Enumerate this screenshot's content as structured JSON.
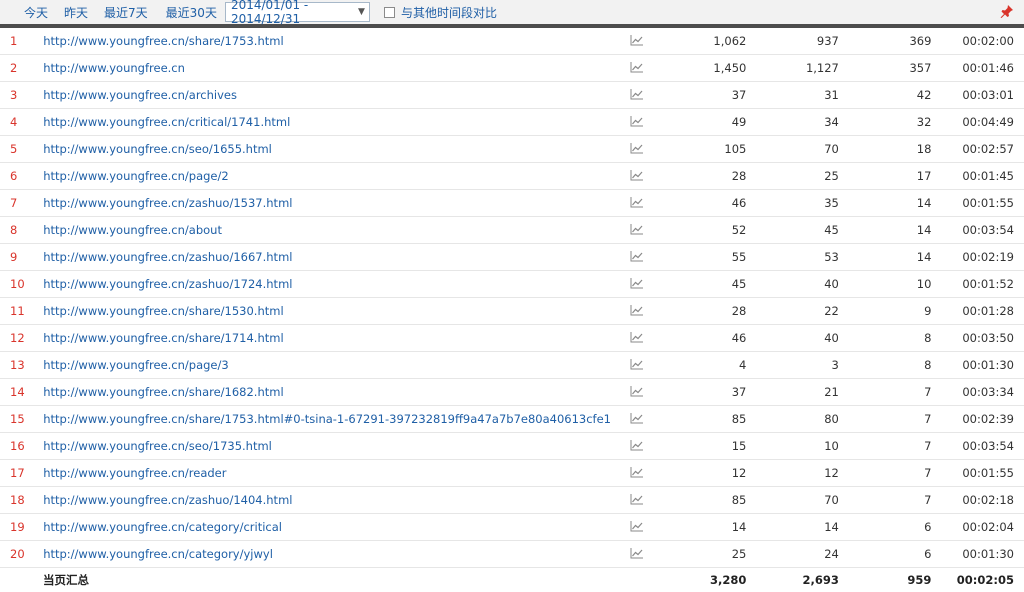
{
  "toolbar": {
    "quick_ranges": [
      "今天",
      "昨天",
      "最近7天",
      "最近30天"
    ],
    "date_range": "2014/01/01 - 2014/12/31",
    "compare_label": "与其他时间段对比",
    "compare_checked": false
  },
  "rows": [
    {
      "index": "1",
      "url": "http://www.youngfree.cn/share/1753.html",
      "c1": "1,062",
      "c2": "937",
      "c3": "369",
      "time": "00:02:00"
    },
    {
      "index": "2",
      "url": "http://www.youngfree.cn",
      "c1": "1,450",
      "c2": "1,127",
      "c3": "357",
      "time": "00:01:46"
    },
    {
      "index": "3",
      "url": "http://www.youngfree.cn/archives",
      "c1": "37",
      "c2": "31",
      "c3": "42",
      "time": "00:03:01"
    },
    {
      "index": "4",
      "url": "http://www.youngfree.cn/critical/1741.html",
      "c1": "49",
      "c2": "34",
      "c3": "32",
      "time": "00:04:49"
    },
    {
      "index": "5",
      "url": "http://www.youngfree.cn/seo/1655.html",
      "c1": "105",
      "c2": "70",
      "c3": "18",
      "time": "00:02:57"
    },
    {
      "index": "6",
      "url": "http://www.youngfree.cn/page/2",
      "c1": "28",
      "c2": "25",
      "c3": "17",
      "time": "00:01:45"
    },
    {
      "index": "7",
      "url": "http://www.youngfree.cn/zashuo/1537.html",
      "c1": "46",
      "c2": "35",
      "c3": "14",
      "time": "00:01:55"
    },
    {
      "index": "8",
      "url": "http://www.youngfree.cn/about",
      "c1": "52",
      "c2": "45",
      "c3": "14",
      "time": "00:03:54"
    },
    {
      "index": "9",
      "url": "http://www.youngfree.cn/zashuo/1667.html",
      "c1": "55",
      "c2": "53",
      "c3": "14",
      "time": "00:02:19"
    },
    {
      "index": "10",
      "url": "http://www.youngfree.cn/zashuo/1724.html",
      "c1": "45",
      "c2": "40",
      "c3": "10",
      "time": "00:01:52"
    },
    {
      "index": "11",
      "url": "http://www.youngfree.cn/share/1530.html",
      "c1": "28",
      "c2": "22",
      "c3": "9",
      "time": "00:01:28"
    },
    {
      "index": "12",
      "url": "http://www.youngfree.cn/share/1714.html",
      "c1": "46",
      "c2": "40",
      "c3": "8",
      "time": "00:03:50"
    },
    {
      "index": "13",
      "url": "http://www.youngfree.cn/page/3",
      "c1": "4",
      "c2": "3",
      "c3": "8",
      "time": "00:01:30"
    },
    {
      "index": "14",
      "url": "http://www.youngfree.cn/share/1682.html",
      "c1": "37",
      "c2": "21",
      "c3": "7",
      "time": "00:03:34"
    },
    {
      "index": "15",
      "url": "http://www.youngfree.cn/share/1753.html#0-tsina-1-67291-397232819ff9a47a7b7e80a40613cfe1",
      "c1": "85",
      "c2": "80",
      "c3": "7",
      "time": "00:02:39"
    },
    {
      "index": "16",
      "url": "http://www.youngfree.cn/seo/1735.html",
      "c1": "15",
      "c2": "10",
      "c3": "7",
      "time": "00:03:54"
    },
    {
      "index": "17",
      "url": "http://www.youngfree.cn/reader",
      "c1": "12",
      "c2": "12",
      "c3": "7",
      "time": "00:01:55"
    },
    {
      "index": "18",
      "url": "http://www.youngfree.cn/zashuo/1404.html",
      "c1": "85",
      "c2": "70",
      "c3": "7",
      "time": "00:02:18"
    },
    {
      "index": "19",
      "url": "http://www.youngfree.cn/category/critical",
      "c1": "14",
      "c2": "14",
      "c3": "6",
      "time": "00:02:04"
    },
    {
      "index": "20",
      "url": "http://www.youngfree.cn/category/yjwyl",
      "c1": "25",
      "c2": "24",
      "c3": "6",
      "time": "00:01:30"
    }
  ],
  "total": {
    "label": "当页汇总",
    "c1": "3,280",
    "c2": "2,693",
    "c3": "959",
    "time": "00:02:05"
  },
  "icons": {
    "trend": "line-chart-icon",
    "pin": "pin-icon",
    "dropdown": "caret-down-icon"
  },
  "colors": {
    "link": "#1f5fa6",
    "index": "#d9342b",
    "toolbar_bg": "#f2f2f2",
    "header_rule": "#4d4d4d",
    "pin": "#d9342b"
  }
}
